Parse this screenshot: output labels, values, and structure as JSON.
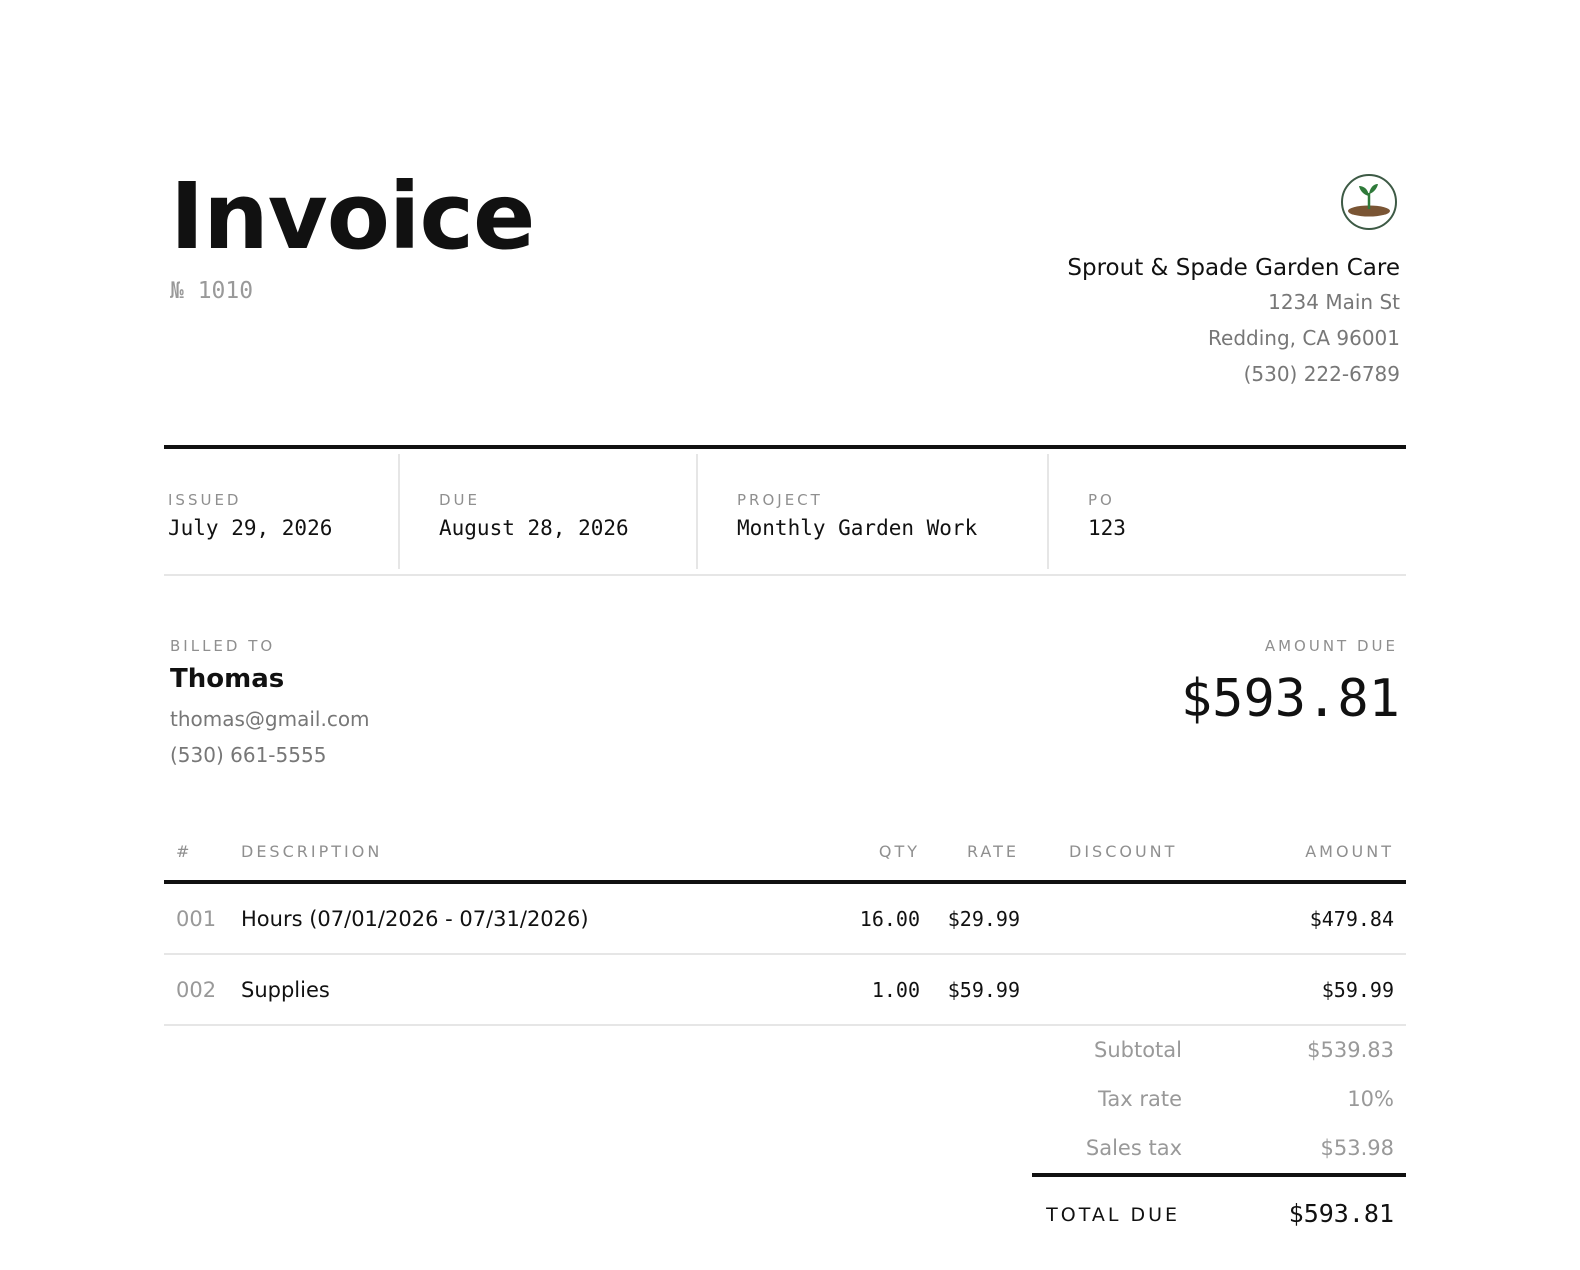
{
  "document": {
    "title": "Invoice",
    "number": "№ 1010"
  },
  "company": {
    "logo_icon": "seedling-icon",
    "name": "Sprout & Spade Garden Care",
    "address_line1": "1234 Main St",
    "address_line2": "Redding, CA 96001",
    "phone": "(530) 222-6789"
  },
  "meta": {
    "issued_label": "ISSUED",
    "issued_value": "July 29, 2026",
    "due_label": "DUE",
    "due_value": "August 28, 2026",
    "project_label": "PROJECT",
    "project_value": "Monthly Garden Work",
    "po_label": "PO",
    "po_value": "123"
  },
  "billed_to": {
    "label": "BILLED TO",
    "name": "Thomas",
    "email": "thomas@gmail.com",
    "phone": "(530) 661-5555"
  },
  "amount_due": {
    "label": "AMOUNT DUE",
    "value": "$593.81"
  },
  "table": {
    "headers": {
      "num": "#",
      "description": "DESCRIPTION",
      "qty": "QTY",
      "rate": "RATE",
      "discount": "DISCOUNT",
      "amount": "AMOUNT"
    },
    "rows": [
      {
        "num": "001",
        "description": "Hours (07/01/2026 - 07/31/2026)",
        "qty": "16.00",
        "rate": "$29.99",
        "discount": "",
        "amount": "$479.84"
      },
      {
        "num": "002",
        "description": "Supplies",
        "qty": "1.00",
        "rate": "$59.99",
        "discount": "",
        "amount": "$59.99"
      }
    ]
  },
  "summary": {
    "subtotal_label": "Subtotal",
    "subtotal_value": "$539.83",
    "tax_rate_label": "Tax rate",
    "tax_rate_value": "10%",
    "sales_tax_label": "Sales tax",
    "sales_tax_value": "$53.98",
    "total_label": "TOTAL DUE",
    "total_value": "$593.81"
  },
  "colors": {
    "ink": "#111111",
    "muted": "#999999",
    "rule_light": "#e6e6e6",
    "logo_ring": "#3d5a45",
    "logo_leaf": "#2f7a3a",
    "logo_soil": "#7a5534"
  }
}
